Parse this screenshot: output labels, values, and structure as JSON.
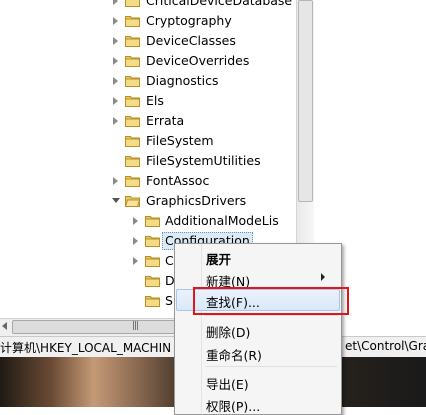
{
  "tree": {
    "items": [
      {
        "label": "CriticalDeviceDatabase",
        "arrow": "closed"
      },
      {
        "label": "Cryptography",
        "arrow": "closed"
      },
      {
        "label": "DeviceClasses",
        "arrow": "closed"
      },
      {
        "label": "DeviceOverrides",
        "arrow": "closed"
      },
      {
        "label": "Diagnostics",
        "arrow": "closed"
      },
      {
        "label": "Els",
        "arrow": "closed"
      },
      {
        "label": "Errata",
        "arrow": "closed"
      },
      {
        "label": "FileSystem",
        "arrow": "none"
      },
      {
        "label": "FileSystemUtilities",
        "arrow": "none"
      },
      {
        "label": "FontAssoc",
        "arrow": "closed"
      },
      {
        "label": "GraphicsDrivers",
        "arrow": "open"
      }
    ],
    "children": [
      {
        "label": "AdditionalModeLis",
        "arrow": "closed"
      },
      {
        "label": "Configuration",
        "arrow": "closed",
        "selected": true
      },
      {
        "label": "C",
        "arrow": "closed"
      },
      {
        "label": "D",
        "arrow": "none"
      },
      {
        "label": "S",
        "arrow": "none"
      }
    ]
  },
  "scrollbar": {
    "grip": "|||"
  },
  "statusbar": {
    "path_left": "计算机\\HKEY_LOCAL_MACHIN",
    "path_right": "et\\Control\\Grap"
  },
  "context_menu": {
    "items": [
      {
        "label": "展开",
        "bold": true
      },
      {
        "label": "新建(N)",
        "has_submenu": true
      },
      {
        "label": "查找(F)...",
        "highlighted": true
      },
      {
        "label": "删除(D)"
      },
      {
        "label": "重命名(R)"
      },
      {
        "label": "导出(E)"
      },
      {
        "label": "权限(P)..."
      }
    ]
  },
  "colors": {
    "highlight_box": "#e0161b",
    "selection": "#dce9f7",
    "folder": "#e8c65a"
  },
  "icons": {
    "folder": "folder-icon",
    "expand": "expand-arrow-icon",
    "submenu": "submenu-arrow-icon"
  }
}
